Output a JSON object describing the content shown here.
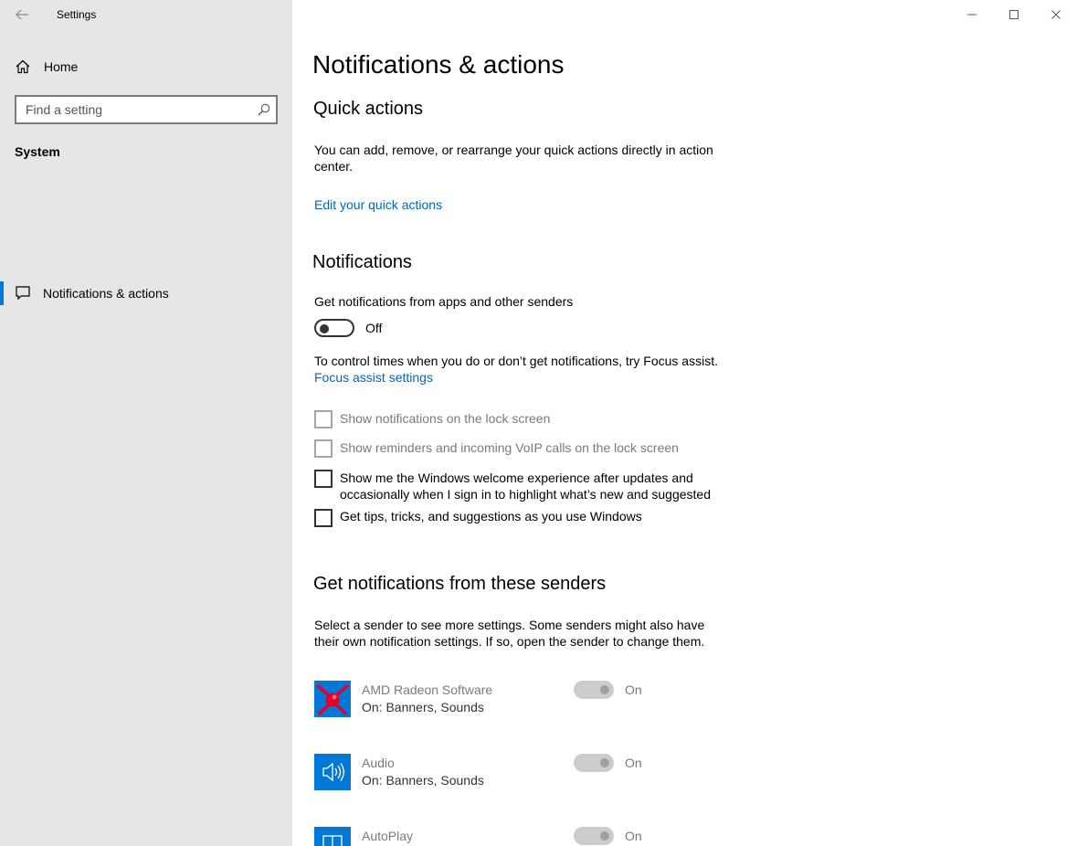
{
  "window": {
    "title": "Settings",
    "controls": {
      "minimize": "minimize-icon",
      "maximize": "maximize-icon",
      "close": "close-icon"
    }
  },
  "sidebar": {
    "home_label": "Home",
    "search_placeholder": "Find a setting",
    "section_label": "System",
    "items": [
      {
        "label": "Notifications & actions",
        "icon": "message-icon",
        "selected": true
      }
    ]
  },
  "main": {
    "page_title": "Notifications & actions",
    "quick_actions": {
      "heading": "Quick actions",
      "description": "You can add, remove, or rearrange your quick actions directly in action center.",
      "link": "Edit your quick actions"
    },
    "notifications": {
      "heading": "Notifications",
      "toggle_label": "Get notifications from apps and other senders",
      "toggle_state": "Off",
      "focus_text": "To control times when you do or don’t get notifications, try Focus assist.",
      "focus_link": "Focus assist settings",
      "checkboxes": [
        {
          "label": "Show notifications on the lock screen",
          "checked": false,
          "disabled": true
        },
        {
          "label": "Show reminders and incoming VoIP calls on the lock screen",
          "checked": false,
          "disabled": true
        },
        {
          "label": "Show me the Windows welcome experience after updates and occasionally when I sign in to highlight what’s new and suggested",
          "checked": false,
          "disabled": false
        },
        {
          "label": "Get tips, tricks, and suggestions as you use Windows",
          "checked": false,
          "disabled": false
        }
      ]
    },
    "senders": {
      "heading": "Get notifications from these senders",
      "description": "Select a sender to see more settings. Some senders might also have their own notification settings. If so, open the sender to change them.",
      "apps": [
        {
          "name": "AMD Radeon Software",
          "status": "On: Banners, Sounds",
          "toggle": "On",
          "icon": "amd-radeon-icon"
        },
        {
          "name": "Audio",
          "status": "On: Banners, Sounds",
          "toggle": "On",
          "icon": "speaker-icon"
        },
        {
          "name": "AutoPlay",
          "status": "",
          "toggle": "On",
          "icon": "autoplay-icon"
        }
      ]
    }
  },
  "colors": {
    "accent": "#0078d7",
    "link": "#0067b8",
    "sidebar_bg": "#e6e6e6",
    "amd_red": "#e4002b"
  }
}
